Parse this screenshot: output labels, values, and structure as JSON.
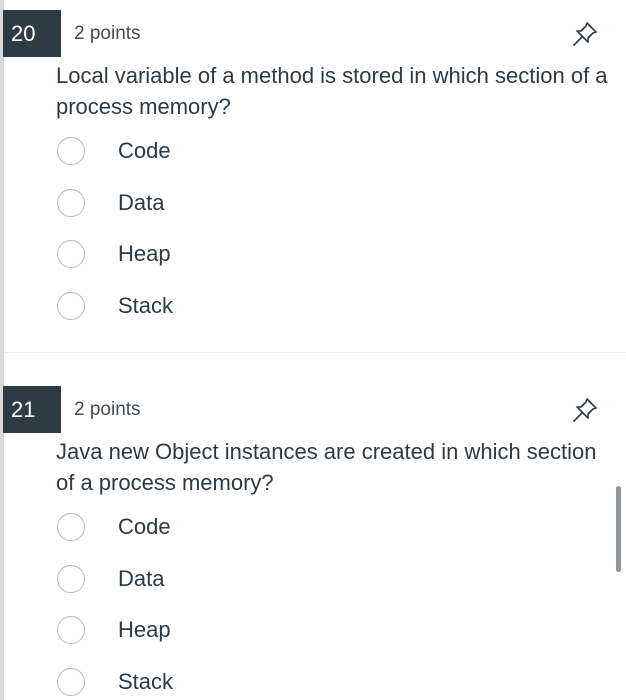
{
  "questions": [
    {
      "number": "20",
      "points": "2 points",
      "text": "Local variable of a method is stored in which section of a process memory?",
      "options": [
        "Code",
        "Data",
        "Heap",
        "Stack"
      ]
    },
    {
      "number": "21",
      "points": "2 points",
      "text": "Java new Object instances are created in which section of a process memory?",
      "options": [
        "Code",
        "Data",
        "Heap",
        "Stack"
      ]
    }
  ],
  "icons": {
    "pin": "pin-icon",
    "radio": "radio-button"
  },
  "colors": {
    "number_badge_bg": "#2d3b45",
    "text": "#2d3b45",
    "radio_border": "#b4b9bc"
  }
}
